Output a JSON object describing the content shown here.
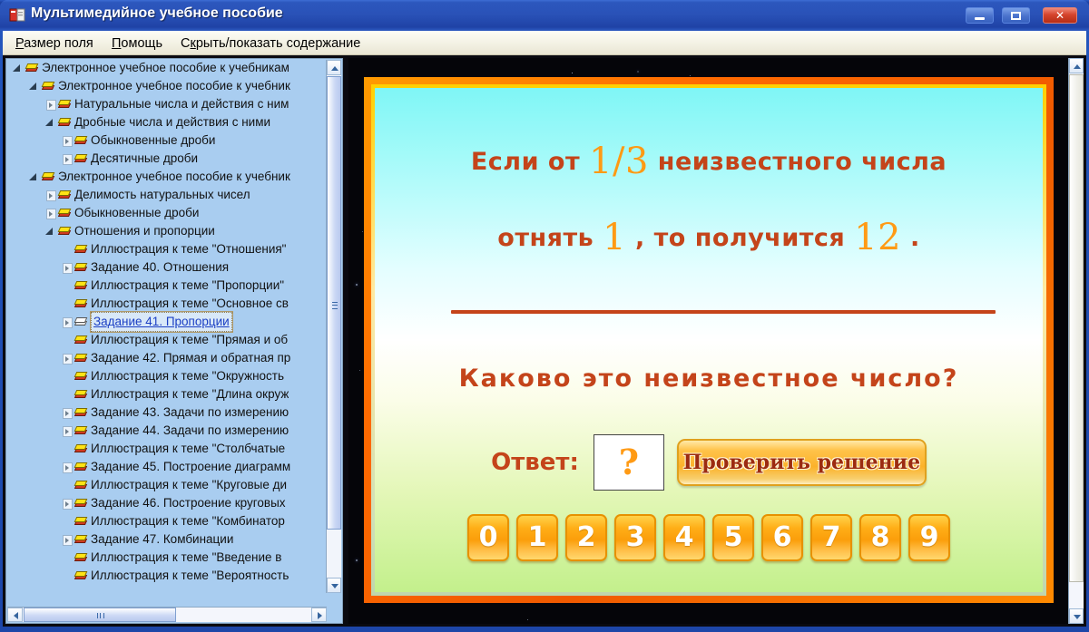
{
  "window": {
    "title": "Мультимедийное учебное пособие",
    "icon": "book-app-icon",
    "minimize_label": "Свернуть",
    "maximize_label": "Развернуть",
    "close_label": "Закрыть",
    "close_glyph": "✕"
  },
  "menu": [
    {
      "label": "Размер поля",
      "mnemonic": "Р"
    },
    {
      "label": "Помощь",
      "mnemonic": "П"
    },
    {
      "label": "Скрыть/показать содержание",
      "mnemonic": "к"
    }
  ],
  "tree": {
    "nodes": [
      {
        "depth": 0,
        "expander": "expanded",
        "icon": "closed-book-icon",
        "label": "Электронное учебное пособие к учебникам",
        "selected": false
      },
      {
        "depth": 1,
        "expander": "expanded",
        "icon": "closed-book-icon",
        "label": "Электронное учебное пособие к учебник",
        "selected": false
      },
      {
        "depth": 2,
        "expander": "collapsed",
        "icon": "closed-book-icon",
        "label": "Натуральные числа и действия с ним",
        "selected": false
      },
      {
        "depth": 2,
        "expander": "expanded",
        "icon": "closed-book-icon",
        "label": "Дробные числа и действия с ними",
        "selected": false
      },
      {
        "depth": 3,
        "expander": "collapsed",
        "icon": "closed-book-icon",
        "label": "Обыкновенные дроби",
        "selected": false
      },
      {
        "depth": 3,
        "expander": "collapsed",
        "icon": "closed-book-icon",
        "label": "Десятичные дроби",
        "selected": false
      },
      {
        "depth": 1,
        "expander": "expanded",
        "icon": "closed-book-icon",
        "label": "Электронное учебное пособие к учебник",
        "selected": false
      },
      {
        "depth": 2,
        "expander": "collapsed",
        "icon": "closed-book-icon",
        "label": "Делимость натуральных чисел",
        "selected": false
      },
      {
        "depth": 2,
        "expander": "collapsed",
        "icon": "closed-book-icon",
        "label": "Обыкновенные дроби",
        "selected": false
      },
      {
        "depth": 2,
        "expander": "expanded",
        "icon": "closed-book-icon",
        "label": "Отношения и пропорции",
        "selected": false
      },
      {
        "depth": 3,
        "expander": "none",
        "icon": "closed-book-icon",
        "label": "Иллюстрация к теме \"Отношения\"",
        "selected": false
      },
      {
        "depth": 3,
        "expander": "collapsed",
        "icon": "closed-book-icon",
        "label": "Задание 40. Отношения",
        "selected": false
      },
      {
        "depth": 3,
        "expander": "none",
        "icon": "closed-book-icon",
        "label": "Иллюстрация к теме \"Пропорции\"",
        "selected": false
      },
      {
        "depth": 3,
        "expander": "none",
        "icon": "closed-book-icon",
        "label": "Иллюстрация к теме \"Основное св",
        "selected": false
      },
      {
        "depth": 3,
        "expander": "collapsed",
        "icon": "open-book-icon",
        "label": "Задание 41. Пропорции",
        "selected": true
      },
      {
        "depth": 3,
        "expander": "none",
        "icon": "closed-book-icon",
        "label": "Иллюстрация к теме \"Прямая и об",
        "selected": false
      },
      {
        "depth": 3,
        "expander": "collapsed",
        "icon": "closed-book-icon",
        "label": "Задание 42. Прямая и обратная пр",
        "selected": false
      },
      {
        "depth": 3,
        "expander": "none",
        "icon": "closed-book-icon",
        "label": "Иллюстрация к теме \"Окружность",
        "selected": false
      },
      {
        "depth": 3,
        "expander": "none",
        "icon": "closed-book-icon",
        "label": "Иллюстрация к теме \"Длина окруж",
        "selected": false
      },
      {
        "depth": 3,
        "expander": "collapsed",
        "icon": "closed-book-icon",
        "label": "Задание 43. Задачи по измерению",
        "selected": false
      },
      {
        "depth": 3,
        "expander": "collapsed",
        "icon": "closed-book-icon",
        "label": "Задание 44. Задачи по измерению",
        "selected": false
      },
      {
        "depth": 3,
        "expander": "none",
        "icon": "closed-book-icon",
        "label": "Иллюстрация к теме \"Столбчатые",
        "selected": false
      },
      {
        "depth": 3,
        "expander": "collapsed",
        "icon": "closed-book-icon",
        "label": "Задание 45. Построение диаграмм",
        "selected": false
      },
      {
        "depth": 3,
        "expander": "none",
        "icon": "closed-book-icon",
        "label": "Иллюстрация к теме \"Круговые ди",
        "selected": false
      },
      {
        "depth": 3,
        "expander": "collapsed",
        "icon": "closed-book-icon",
        "label": "Задание 46. Построение круговых",
        "selected": false
      },
      {
        "depth": 3,
        "expander": "none",
        "icon": "closed-book-icon",
        "label": "Иллюстрация к теме \"Комбинатор",
        "selected": false
      },
      {
        "depth": 3,
        "expander": "collapsed",
        "icon": "closed-book-icon",
        "label": "Задание 47. Комбинации",
        "selected": false
      },
      {
        "depth": 3,
        "expander": "none",
        "icon": "closed-book-icon",
        "label": "Иллюстрация к теме \"Введение в",
        "selected": false
      },
      {
        "depth": 3,
        "expander": "none",
        "icon": "closed-book-icon",
        "label": "Иллюстрация к теме \"Вероятность",
        "selected": false
      }
    ]
  },
  "slide": {
    "problem_line1_a": "Если от",
    "problem_line1_num": "1/3",
    "problem_line1_b": "неизвестного числа",
    "problem_line2_a": "отнять",
    "problem_line2_num1": "1",
    "problem_line2_b": ",  то  получится",
    "problem_line2_num2": "12",
    "problem_line2_c": ".",
    "question": "Каково  это  неизвестное  число?",
    "answer_label": "Ответ:",
    "answer_value": "?",
    "check_button": "Проверить решение",
    "numpad": [
      "0",
      "1",
      "2",
      "3",
      "4",
      "5",
      "6",
      "7",
      "8",
      "9"
    ]
  },
  "colors": {
    "slide_border": "#ff6a00",
    "text_brown": "#c4441a",
    "number_orange": "#ff9a14",
    "key_orange": "#ffae17",
    "tree_background": "#a9cdf0",
    "titlebar_blue": "#2a52b8"
  }
}
